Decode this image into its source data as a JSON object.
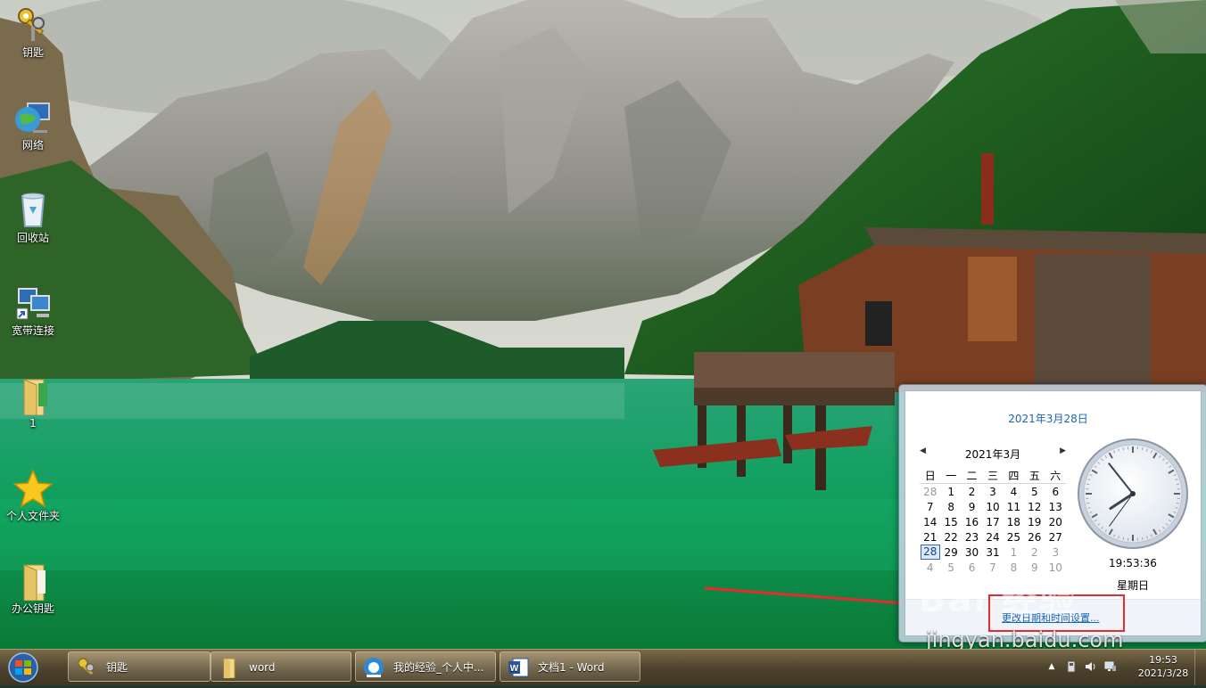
{
  "desktop": {
    "icons": [
      {
        "label": "钥匙",
        "icon": "keys-icon"
      },
      {
        "label": "网络",
        "icon": "network-globe-icon"
      },
      {
        "label": "回收站",
        "icon": "recycle-bin-icon"
      },
      {
        "label": "宽带连接",
        "icon": "broadband-connection-icon"
      },
      {
        "label": "1",
        "icon": "folder-icon"
      },
      {
        "label": "个人文件夹",
        "icon": "star-icon"
      },
      {
        "label": "办公钥匙",
        "icon": "folder-icon"
      }
    ]
  },
  "clock_popup": {
    "date_header": "2021年3月28日",
    "month_title": "2021年3月",
    "prev_arrow": "◀",
    "next_arrow": "▶",
    "weekdays": [
      "日",
      "一",
      "二",
      "三",
      "四",
      "五",
      "六"
    ],
    "weeks": [
      [
        {
          "d": "28",
          "other": true
        },
        {
          "d": "1"
        },
        {
          "d": "2"
        },
        {
          "d": "3"
        },
        {
          "d": "4"
        },
        {
          "d": "5"
        },
        {
          "d": "6"
        }
      ],
      [
        {
          "d": "7"
        },
        {
          "d": "8"
        },
        {
          "d": "9"
        },
        {
          "d": "10"
        },
        {
          "d": "11"
        },
        {
          "d": "12"
        },
        {
          "d": "13"
        }
      ],
      [
        {
          "d": "14"
        },
        {
          "d": "15"
        },
        {
          "d": "16"
        },
        {
          "d": "17"
        },
        {
          "d": "18"
        },
        {
          "d": "19"
        },
        {
          "d": "20"
        }
      ],
      [
        {
          "d": "21"
        },
        {
          "d": "22"
        },
        {
          "d": "23"
        },
        {
          "d": "24"
        },
        {
          "d": "25"
        },
        {
          "d": "26"
        },
        {
          "d": "27"
        }
      ],
      [
        {
          "d": "28",
          "today": true
        },
        {
          "d": "29"
        },
        {
          "d": "30"
        },
        {
          "d": "31"
        },
        {
          "d": "1",
          "other": true
        },
        {
          "d": "2",
          "other": true
        },
        {
          "d": "3",
          "other": true
        }
      ],
      [
        {
          "d": "4",
          "other": true
        },
        {
          "d": "5",
          "other": true
        },
        {
          "d": "6",
          "other": true
        },
        {
          "d": "7",
          "other": true
        },
        {
          "d": "8",
          "other": true
        },
        {
          "d": "9",
          "other": true
        },
        {
          "d": "10",
          "other": true
        }
      ]
    ],
    "time": "19:53:36",
    "clock_hands": {
      "hour": 19,
      "minute": 53,
      "second": 36
    },
    "weekday": "星期日",
    "change_settings_link": "更改日期和时间设置..."
  },
  "watermark": {
    "brand": "Bai 经验",
    "url": "jingyan.baidu.com"
  },
  "taskbar": {
    "buttons": [
      {
        "label": "钥匙",
        "icon": "keys-icon"
      },
      {
        "label": "word",
        "icon": "folder-icon"
      },
      {
        "label": "我的经验_个人中...",
        "icon": "browser-icon"
      },
      {
        "label": "文档1 - Word",
        "icon": "word-icon"
      }
    ],
    "tray": {
      "show_hidden_icon": "▲",
      "time": "19:53",
      "date": "2021/3/28"
    }
  },
  "colors": {
    "accent_link": "#1a64b4",
    "highlight_box": "#e52b2b",
    "taskbar": "#4e432d"
  }
}
